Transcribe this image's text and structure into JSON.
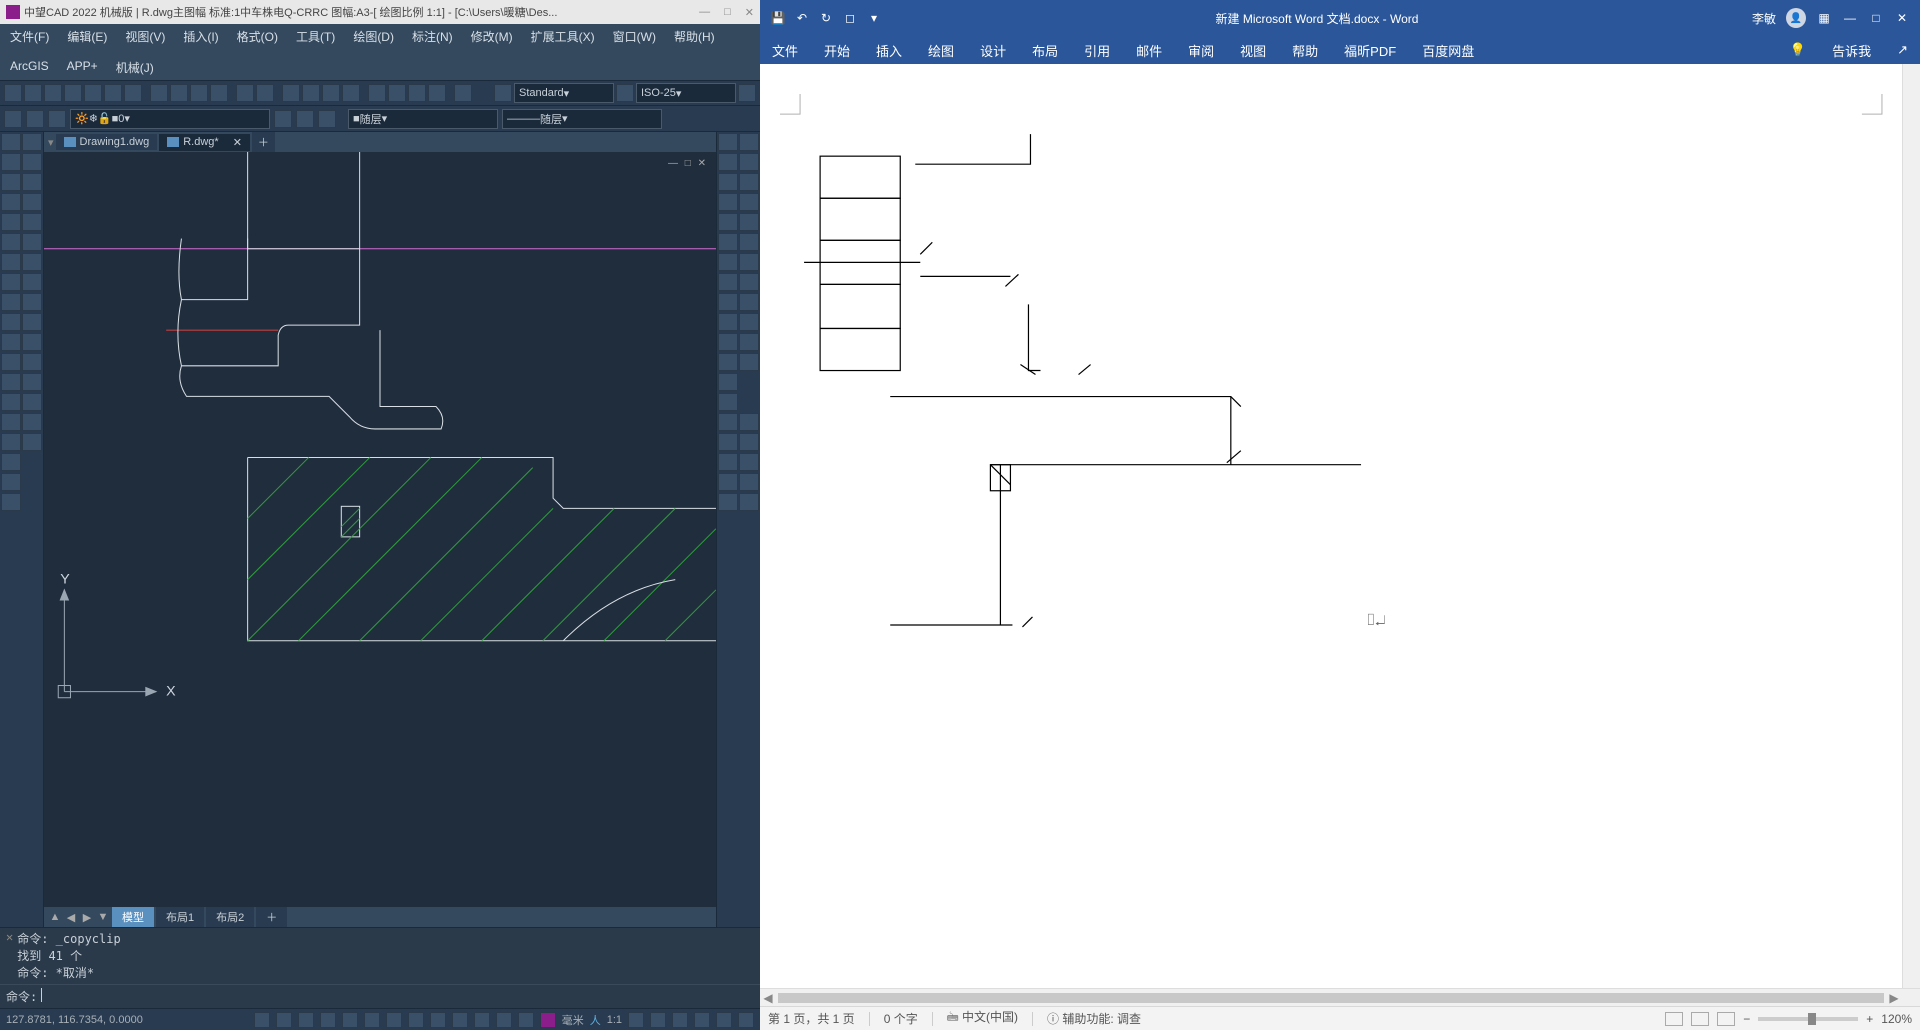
{
  "cad": {
    "title": "中望CAD 2022 机械版 | R.dwg主图幅  标准:1中车株电Q-CRRC 图幅:A3-[ 绘图比例 1:1] - [C:\\Users\\暖糖\\Des...",
    "menus": [
      "文件(F)",
      "编辑(E)",
      "视图(V)",
      "插入(I)",
      "格式(O)",
      "工具(T)",
      "绘图(D)",
      "标注(N)",
      "修改(M)",
      "扩展工具(X)",
      "窗口(W)",
      "帮助(H)",
      "ArcGIS",
      "APP+",
      "机械(J)"
    ],
    "style_sel": "Standard",
    "dim_sel": "ISO-25",
    "layer_sel": "0",
    "linetype1": "随层",
    "linetype2": "随层",
    "tabs": [
      {
        "name": "Drawing1.dwg",
        "active": false
      },
      {
        "name": "R.dwg*",
        "active": true
      }
    ],
    "layout_tabs": [
      "模型",
      "布局1",
      "布局2"
    ],
    "layout_active": "模型",
    "cmd_history": [
      "命令: _copyclip",
      "找到 41 个",
      "命令: *取消*"
    ],
    "cmd_prompt": "命令:",
    "status_coords": "127.8781, 116.7354, 0.0000",
    "status_unit": "毫米",
    "status_scale": "1:1",
    "ucs": {
      "x": "X",
      "y": "Y"
    }
  },
  "word": {
    "title_doc": "新建 Microsoft Word 文档.docx - Word",
    "user": "李敏",
    "ribbon": [
      "文件",
      "开始",
      "插入",
      "绘图",
      "设计",
      "布局",
      "引用",
      "邮件",
      "审阅",
      "视图",
      "帮助",
      "福昕PDF",
      "百度网盘"
    ],
    "tell_me_hint": "告诉我",
    "status": {
      "page": "第 1 页，共 1 页",
      "words": "0 个字",
      "ime": "中文(中国)",
      "accessibility": "辅助功能: 调查",
      "zoom": "120%"
    }
  }
}
